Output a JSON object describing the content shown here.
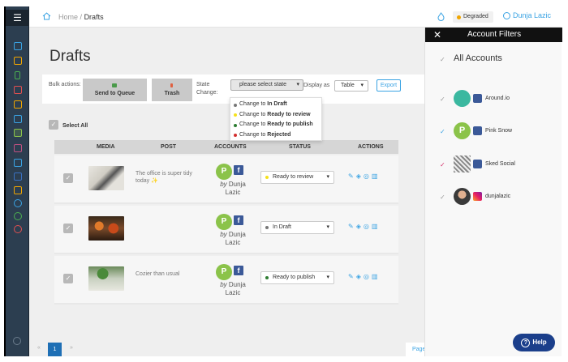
{
  "header": {
    "breadcrumb_home": "Home",
    "breadcrumb_sep": "/",
    "breadcrumb_current": "Drafts",
    "status": "Degraded",
    "user_name": "Dunja Lazic"
  },
  "sidebar": {
    "menu_icon": "☰",
    "items": [
      "home-icon",
      "upload-icon",
      "phone-icon",
      "calendar-icon",
      "analytics-icon",
      "calendar-grid-icon",
      "drafts-icon",
      "message-icon",
      "inbox-icon",
      "users-icon",
      "layers-icon",
      "profile-icon",
      "settings-icon",
      "power-icon"
    ]
  },
  "page": {
    "title": "Drafts"
  },
  "toolbar": {
    "bulk_label": "Bulk actions:",
    "queue_label": "Send to Queue",
    "trash_label": "Trash",
    "state_label": "State Change:",
    "state_placeholder": "please select state",
    "display_label": "Display as",
    "display_value": "Table",
    "export_label": "Export"
  },
  "state_menu": [
    {
      "prefix": "Change to",
      "state": "In Draft",
      "color": "#777777"
    },
    {
      "prefix": "Change to",
      "state": "Ready to review",
      "color": "#f5e11b"
    },
    {
      "prefix": "Change to",
      "state": "Ready to publish",
      "color": "#2e7d32"
    },
    {
      "prefix": "Change to",
      "state": "Rejected",
      "color": "#d32f2f"
    }
  ],
  "select_all_label": "Select All",
  "table": {
    "headers": [
      "MEDIA",
      "POST",
      "ACCOUNTS",
      "STATUS",
      "ACTIONS"
    ],
    "rows": [
      {
        "post": "The office is super tidy today ✨",
        "avatar": "P",
        "network": "f",
        "by": "by",
        "author": "Dunja Lazic",
        "status": "Ready to review",
        "status_color": "#f5e11b"
      },
      {
        "post": "",
        "avatar": "P",
        "network": "f",
        "by": "by",
        "author": "Dunja Lazic",
        "status": "In Draft",
        "status_color": "#777777"
      },
      {
        "post": "Cozier than usual",
        "avatar": "P",
        "network": "f",
        "by": "by",
        "author": "Dunja Lazic",
        "status": "Ready to publish",
        "status_color": "#2e7d32"
      }
    ]
  },
  "pagination": {
    "prev": "«",
    "current": "1",
    "next": "»",
    "page_label": "Page"
  },
  "filters": {
    "title": "Account Filters",
    "all_label": "All Accounts",
    "accounts": [
      {
        "name": "Around.io",
        "network": "facebook",
        "check_color": "#9a9a9a"
      },
      {
        "name": "Pink Snow",
        "network": "facebook",
        "check_color": "#3aa3e3"
      },
      {
        "name": "Sked Social",
        "network": "facebook",
        "check_color": "#d6336c"
      },
      {
        "name": "dunjalazic",
        "network": "instagram",
        "check_color": "#9a9a9a"
      }
    ]
  },
  "help": {
    "label": "Help",
    "icon": "?"
  }
}
